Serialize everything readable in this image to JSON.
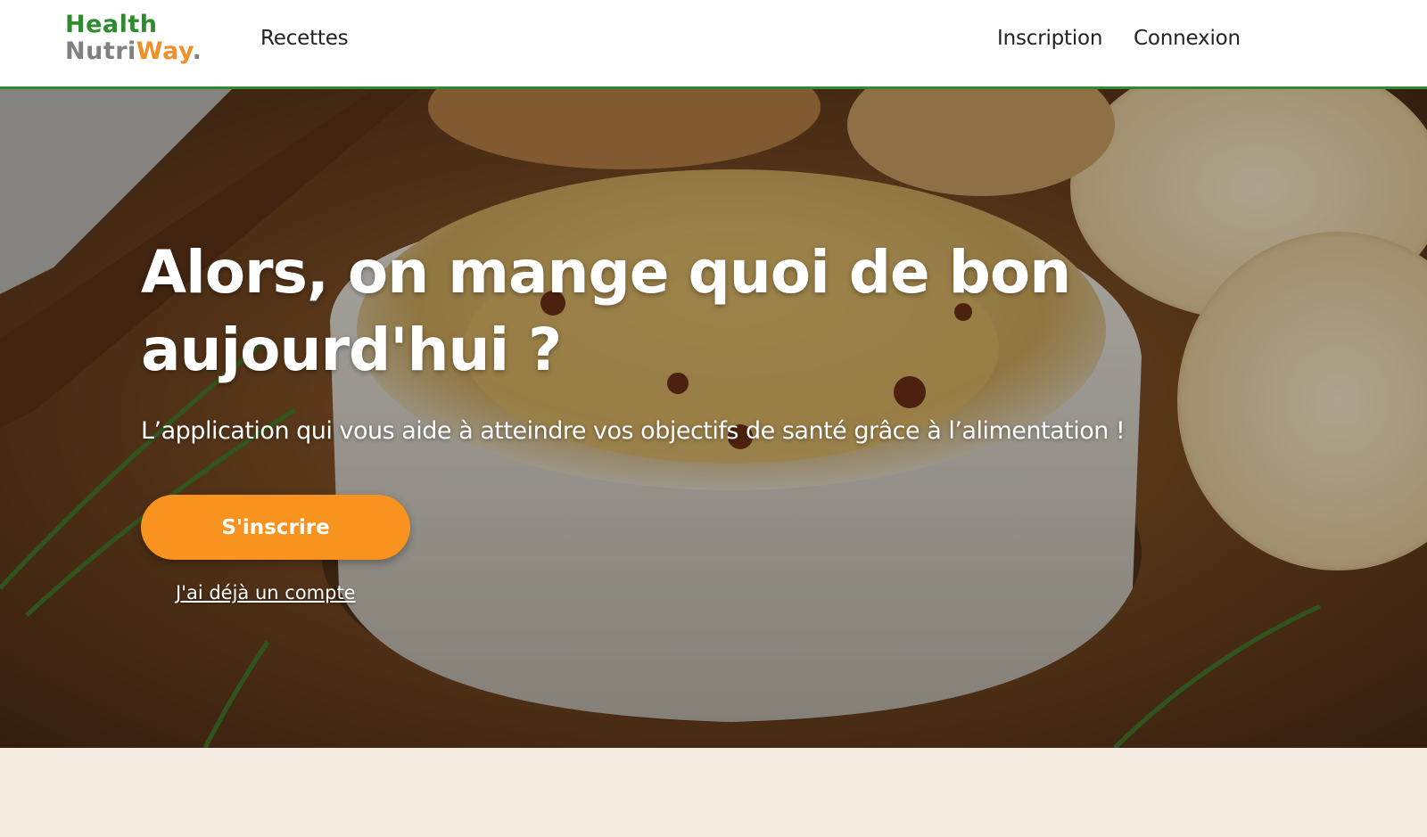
{
  "header": {
    "logo": {
      "line1": "Health",
      "nutri": "Nutri",
      "way": "Way",
      "dot": "."
    },
    "nav": {
      "recettes": "Recettes",
      "inscription": "Inscription",
      "connexion": "Connexion"
    }
  },
  "hero": {
    "title": "Alors, on mange quoi de bon aujourd'hui ?",
    "subtitle": "L’application qui vous aide à atteindre vos objectifs de santé grâce à l’alimentation !",
    "signup_button": "S'inscrire",
    "account_link": "J'ai déjà un compte"
  },
  "colors": {
    "brand_green": "#2e8b2e",
    "brand_orange": "#f7931e",
    "logo_gray": "#808080",
    "page_bg": "#f5ebe1"
  }
}
